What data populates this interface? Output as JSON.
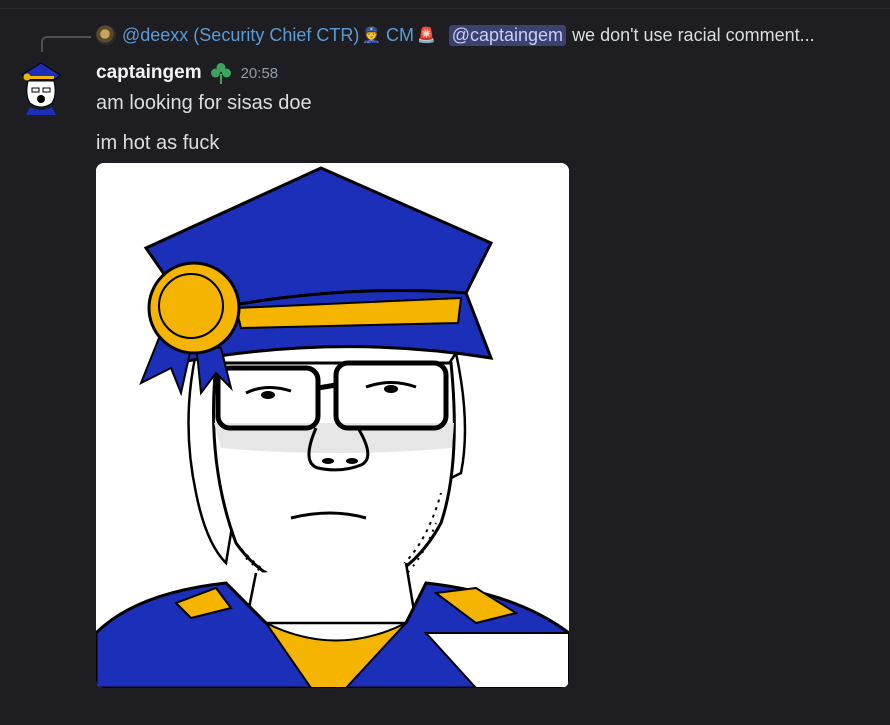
{
  "reply": {
    "author": "@deexx (Security Chief CTR)",
    "author_emoji": "👮",
    "role": "CM",
    "role_emoji": "🚨",
    "mention": "@captaingem",
    "text": "we don't use racial comment..."
  },
  "message": {
    "username": "captaingem",
    "badge_icon": "clover-icon",
    "timestamp": "20:58",
    "lines": [
      "am looking for sisas doe",
      "im hot as fuck"
    ]
  },
  "colors": {
    "background": "#1d1d22",
    "mention_bg": "#3c4270",
    "reply_author": "#5b9bd5",
    "badge": "#3ba55d"
  }
}
